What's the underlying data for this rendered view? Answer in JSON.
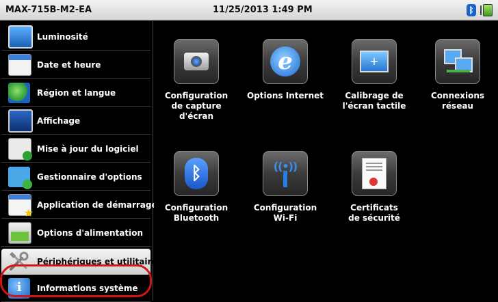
{
  "titlebar": {
    "device": "MAX-715B-M2-EA",
    "datetime": "11/25/2013 1:49 PM",
    "tray": {
      "bluetooth_icon": "bluetooth-icon",
      "battery_icon": "battery-charging-icon"
    }
  },
  "sidebar": {
    "items": [
      {
        "label": "Luminosité",
        "icon": "brightness-icon"
      },
      {
        "label": "Date et heure",
        "icon": "calendar-icon"
      },
      {
        "label": "Région et langue",
        "icon": "globe-icon"
      },
      {
        "label": "Affichage",
        "icon": "display-icon"
      },
      {
        "label": "Mise à jour du logiciel",
        "icon": "software-update-icon"
      },
      {
        "label": "Gestionnaire d'options",
        "icon": "options-manager-icon"
      },
      {
        "label": "Application de démarrage",
        "icon": "startup-app-icon"
      },
      {
        "label": "Options d'alimentation",
        "icon": "power-icon"
      },
      {
        "label": "Périphériques et utilitaires",
        "icon": "tools-icon",
        "selected": true
      },
      {
        "label": "Informations système",
        "icon": "info-icon"
      }
    ]
  },
  "main": {
    "tiles": [
      {
        "label": "Configuration\nde capture\nd'écran",
        "icon": "camera-icon"
      },
      {
        "label": "Options Internet",
        "icon": "internet-explorer-icon"
      },
      {
        "label": "Calibrage de\nl'écran tactile",
        "icon": "touchscreen-calibration-icon"
      },
      {
        "label": "Connexions\nréseau",
        "icon": "network-connections-icon"
      },
      {
        "label": "Configuration\nBluetooth",
        "icon": "bluetooth-icon"
      },
      {
        "label": "Configuration\nWi-Fi",
        "icon": "wifi-icon"
      },
      {
        "label": "Certificats\nde sécurité",
        "icon": "certificate-icon"
      }
    ]
  }
}
